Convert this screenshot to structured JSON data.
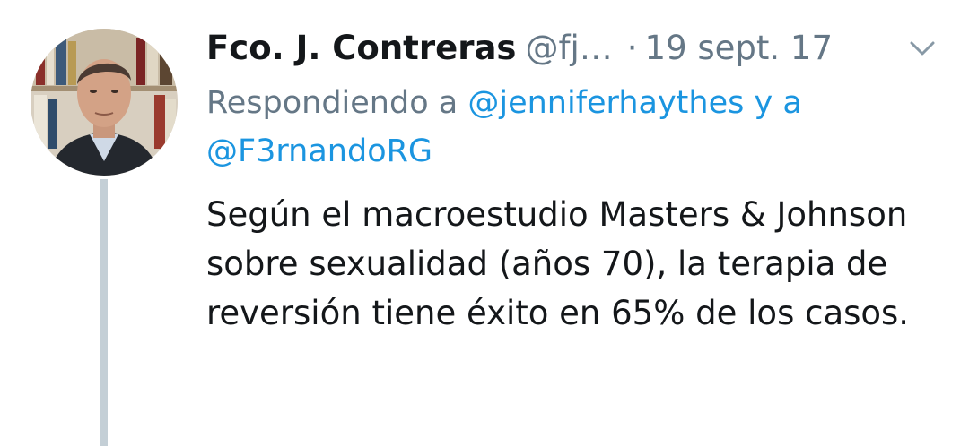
{
  "tweet": {
    "author_name": "Fco. J. Contreras",
    "handle": "@fj…",
    "separator": "·",
    "date": "19 sept. 17",
    "reply_prefix": "Respondiendo a",
    "reply_mention_1": "@jenniferhaythes",
    "reply_conjunction": "y a",
    "reply_mention_2": "@F3rnandoRG",
    "body_text": "Según el macroestudio Masters & Johnson sobre sexualidad (años 70), la terapia de reversión tiene éxito en 65% de los casos."
  },
  "icons": {
    "menu": "chevron-down-icon"
  },
  "colors": {
    "name": "#14171a",
    "secondary": "#657786",
    "mention": "#1b95e0",
    "thread_line": "#c4cfd6",
    "background": "#ffffff"
  }
}
